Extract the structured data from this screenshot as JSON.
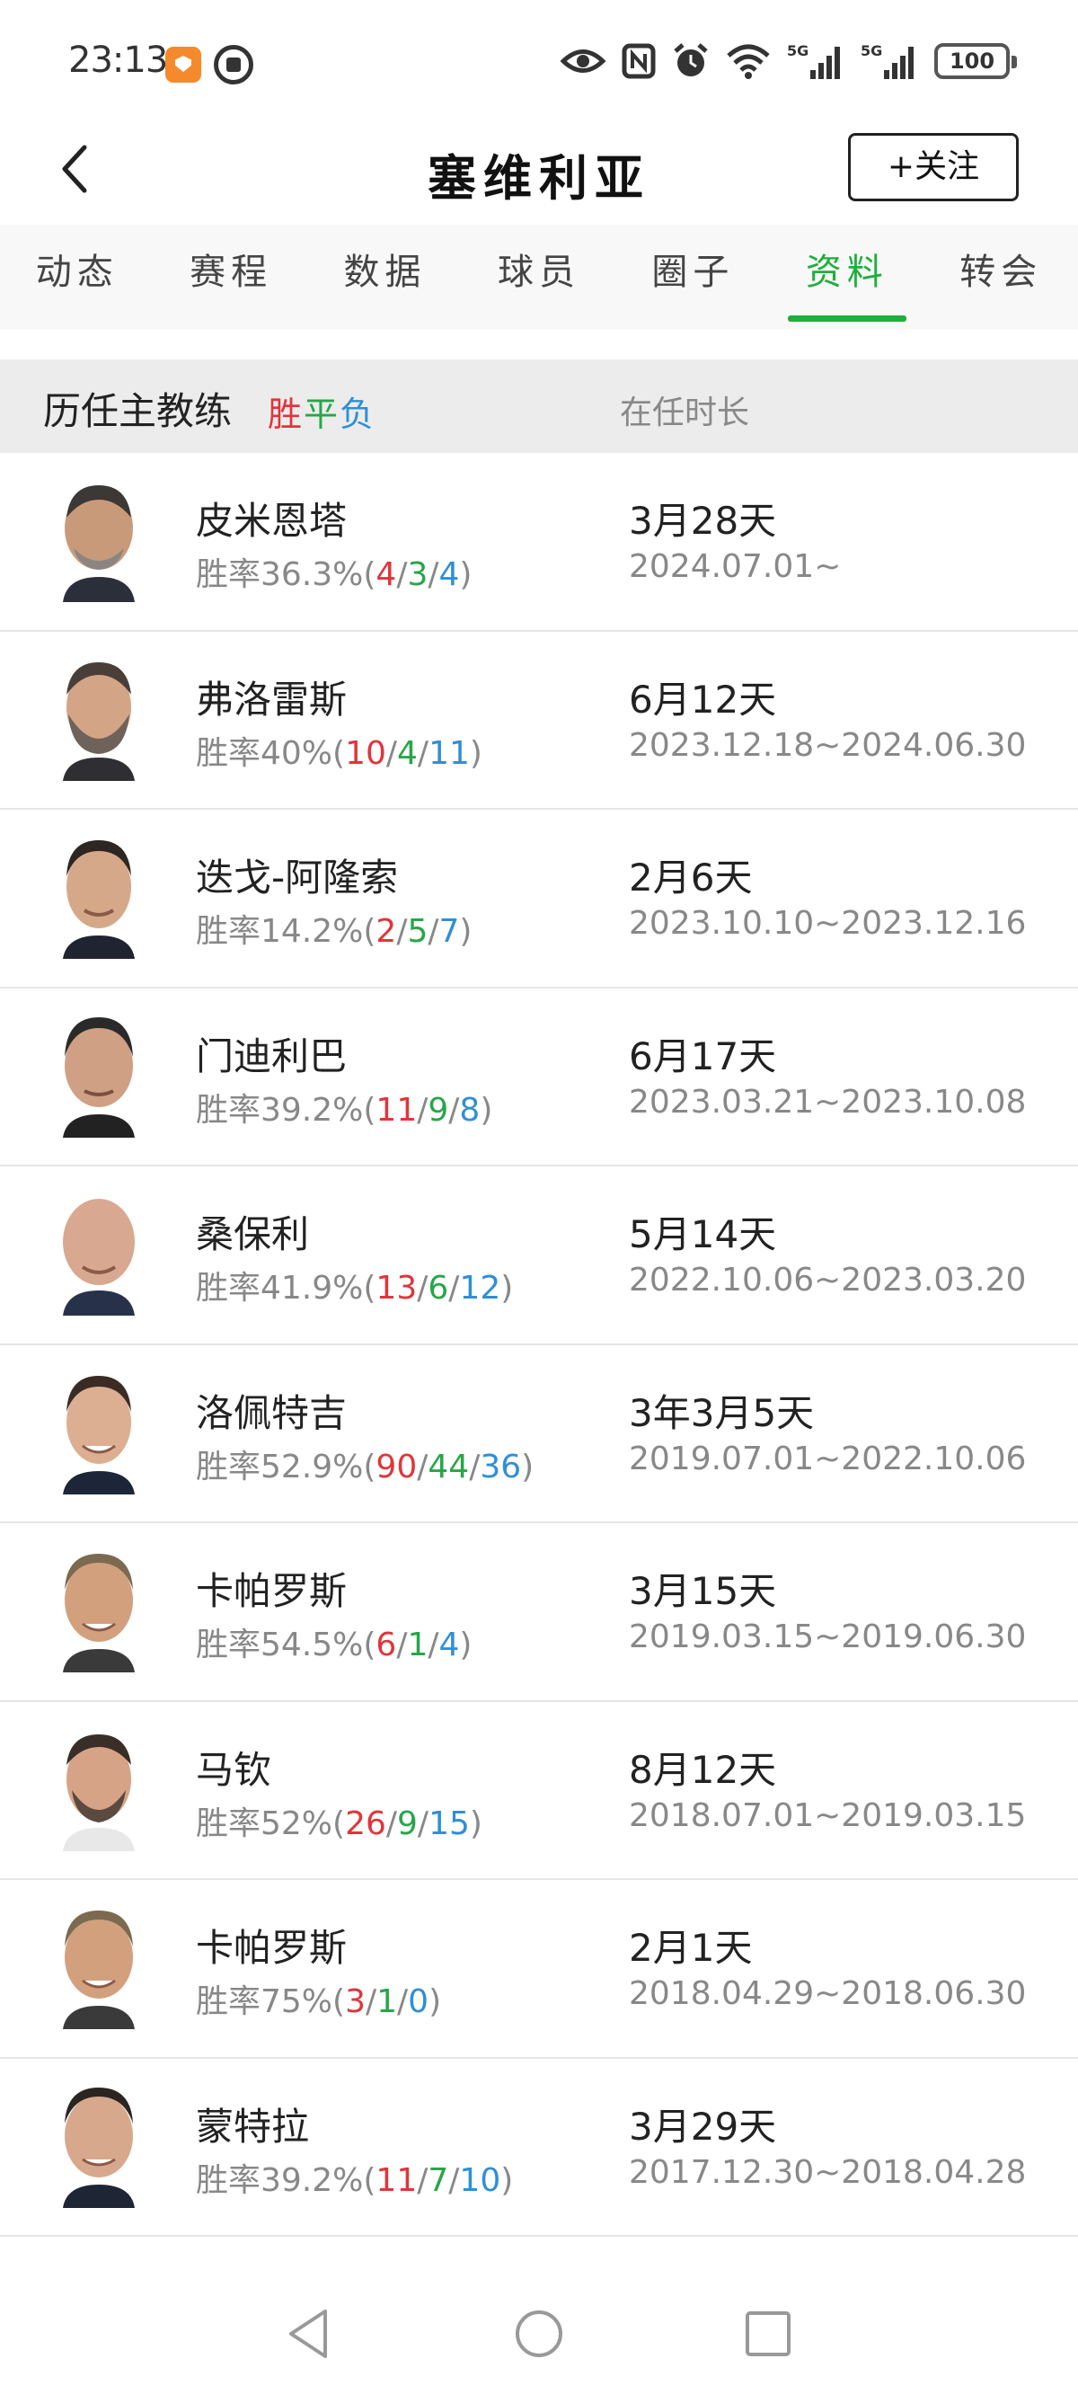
{
  "status_bar": {
    "time": "23:13",
    "signal1": "5G",
    "signal2": "5G",
    "battery": "100"
  },
  "header": {
    "title": "塞维利亚",
    "follow_label": "+关注"
  },
  "tabs": [
    {
      "label": "动态",
      "active": false
    },
    {
      "label": "赛程",
      "active": false
    },
    {
      "label": "数据",
      "active": false
    },
    {
      "label": "球员",
      "active": false
    },
    {
      "label": "圈子",
      "active": false
    },
    {
      "label": "资料",
      "active": true
    },
    {
      "label": "转会",
      "active": false
    }
  ],
  "section": {
    "title": "历任主教练",
    "win": "胜",
    "draw": "平",
    "loss": "负",
    "tenure_header": "在任时长"
  },
  "colors": {
    "accent": "#1fae3c",
    "win": "#e0353a",
    "draw": "#27a648",
    "loss": "#2f8fd6"
  },
  "coaches": [
    {
      "name": "皮米恩塔",
      "rate_prefix": "胜率36.3%(",
      "w": "4",
      "d": "3",
      "l": "4",
      "tenure": "3月28天",
      "dates": "2024.07.01~"
    },
    {
      "name": "弗洛雷斯",
      "rate_prefix": "胜率40%(",
      "w": "10",
      "d": "4",
      "l": "11",
      "tenure": "6月12天",
      "dates": "2023.12.18~2024.06.30"
    },
    {
      "name": "迭戈-阿隆索",
      "rate_prefix": "胜率14.2%(",
      "w": "2",
      "d": "5",
      "l": "7",
      "tenure": "2月6天",
      "dates": "2023.10.10~2023.12.16"
    },
    {
      "name": "门迪利巴",
      "rate_prefix": "胜率39.2%(",
      "w": "11",
      "d": "9",
      "l": "8",
      "tenure": "6月17天",
      "dates": "2023.03.21~2023.10.08"
    },
    {
      "name": "桑保利",
      "rate_prefix": "胜率41.9%(",
      "w": "13",
      "d": "6",
      "l": "12",
      "tenure": "5月14天",
      "dates": "2022.10.06~2023.03.20"
    },
    {
      "name": "洛佩特吉",
      "rate_prefix": "胜率52.9%(",
      "w": "90",
      "d": "44",
      "l": "36",
      "tenure": "3年3月5天",
      "dates": "2019.07.01~2022.10.06"
    },
    {
      "name": "卡帕罗斯",
      "rate_prefix": "胜率54.5%(",
      "w": "6",
      "d": "1",
      "l": "4",
      "tenure": "3月15天",
      "dates": "2019.03.15~2019.06.30"
    },
    {
      "name": "马钦",
      "rate_prefix": "胜率52%(",
      "w": "26",
      "d": "9",
      "l": "15",
      "tenure": "8月12天",
      "dates": "2018.07.01~2019.03.15"
    },
    {
      "name": "卡帕罗斯",
      "rate_prefix": "胜率75%(",
      "w": "3",
      "d": "1",
      "l": "0",
      "tenure": "2月1天",
      "dates": "2018.04.29~2018.06.30"
    },
    {
      "name": "蒙特拉",
      "rate_prefix": "胜率39.2%(",
      "w": "11",
      "d": "7",
      "l": "10",
      "tenure": "3月29天",
      "dates": "2017.12.30~2018.04.28"
    }
  ],
  "nav": {
    "back": "back-triangle",
    "home": "home-circle",
    "recents": "recents-square"
  }
}
